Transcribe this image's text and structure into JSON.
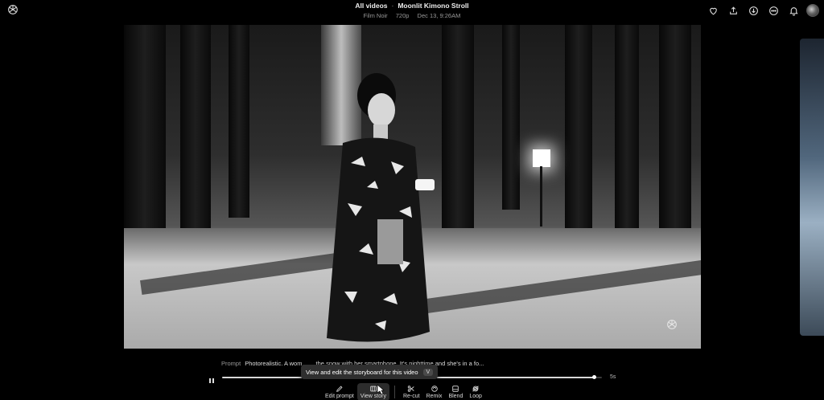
{
  "header": {
    "breadcrumb": "All videos",
    "separator": "·",
    "title": "Moonlit Kimono Stroll",
    "meta": [
      "Film Noir",
      "720p",
      "Dec 13, 9:26AM"
    ]
  },
  "top_actions": [
    {
      "name": "favorite-heart-icon"
    },
    {
      "name": "share-upload-icon"
    },
    {
      "name": "download-icon"
    },
    {
      "name": "more-options-icon"
    },
    {
      "name": "notifications-bell-icon"
    }
  ],
  "prompt": {
    "label": "Prompt",
    "text": "Photorealistic. A wom… …the snow with her smartphone. It's nighttime and she's in a fo..."
  },
  "tooltip": {
    "text": "View and edit the storyboard for this video",
    "shortcut": "V"
  },
  "player": {
    "progress": 0.98,
    "duration": "5s"
  },
  "toolbar": {
    "edit_prompt": "Edit prompt",
    "view_story": "View story",
    "recut": "Re-cut",
    "remix": "Remix",
    "blend": "Blend",
    "loop": "Loop"
  },
  "colors": {
    "background": "#000000",
    "text": "#ffffff",
    "muted": "#999999"
  }
}
